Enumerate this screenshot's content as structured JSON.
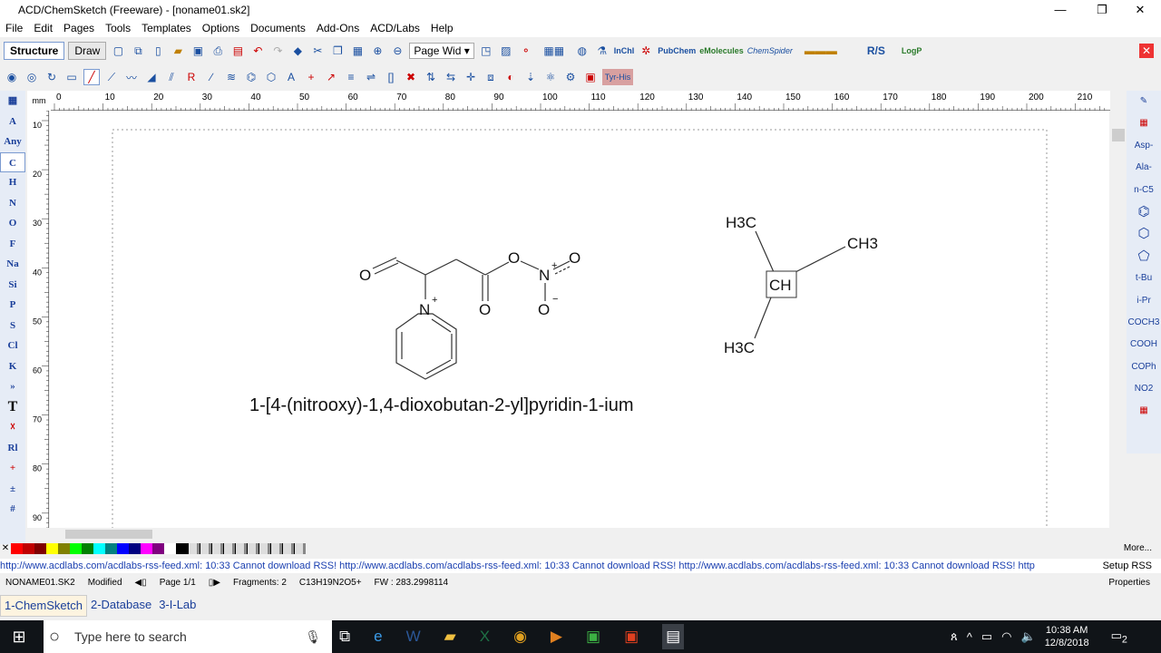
{
  "window": {
    "title": "ACD/ChemSketch (Freeware) - [noname01.sk2]",
    "minimize": "—",
    "restore": "❐",
    "close": "✕"
  },
  "menu": [
    "File",
    "Edit",
    "Pages",
    "Tools",
    "Templates",
    "Options",
    "Documents",
    "Add-Ons",
    "ACD/Labs",
    "Help"
  ],
  "toolbar": {
    "structure": "Structure",
    "draw": "Draw",
    "zoom_select": "Page Wid",
    "pubchem": "PubChem",
    "emolecules": "eMolecules",
    "chemspider": "ChemSpider",
    "rs": "R/S",
    "logp": "LogP",
    "inchi": "InChI"
  },
  "left_tools": [
    "A",
    "Any",
    "C",
    "H",
    "N",
    "O",
    "F",
    "Na",
    "Si",
    "P",
    "S",
    "Cl",
    "K",
    "»",
    "T",
    "☓",
    "Rl",
    "+",
    "±",
    "#"
  ],
  "right_tools": [
    "Asp-",
    "Ala-",
    "n-C5",
    "⌬",
    "⬡",
    "⬠",
    "t-Bu",
    "i-Pr",
    "COCH3",
    "COOH",
    "COPh",
    "NO2"
  ],
  "ruler": {
    "unit": "mm",
    "h_ticks": [
      "0",
      "10",
      "20",
      "30",
      "40",
      "50",
      "60",
      "70",
      "80",
      "90",
      "100",
      "110",
      "120",
      "130",
      "140",
      "150",
      "160",
      "170",
      "180",
      "190",
      "200",
      "210"
    ],
    "v_ticks": [
      "10",
      "20",
      "30",
      "40",
      "50",
      "60",
      "70",
      "80",
      "90"
    ]
  },
  "molecule1": {
    "atoms": {
      "o_aldehyde": "O",
      "n_pyr": "N",
      "n_plus": "+",
      "o_carbonyl": "O",
      "o_ester": "O",
      "n_nitro": "N",
      "nitro_plus": "+",
      "o_nitro1": "O",
      "o_nitro2": "O",
      "nitro_minus": "−"
    },
    "name": "1-[4-(nitrooxy)-1,4-dioxobutan-2-yl]pyridin-1-ium"
  },
  "molecule2": {
    "center": "CH",
    "top_left": "H3C",
    "right": "CH3",
    "bottom_left": "H3C"
  },
  "palette": [
    "#ff0000",
    "#c00000",
    "#800000",
    "#ffff00",
    "#808000",
    "#00ff00",
    "#008000",
    "#00ffff",
    "#008080",
    "#0000ff",
    "#000080",
    "#ff00ff",
    "#800080",
    "#ffffff",
    "#000000"
  ],
  "more": "More...",
  "rss": {
    "text": "http://www.acdlabs.com/acdlabs-rss-feed.xml: 10:33 Cannot download RSS!  http://www.acdlabs.com/acdlabs-rss-feed.xml: 10:33 Cannot download RSS!  http://www.acdlabs.com/acdlabs-rss-feed.xml: 10:33 Cannot download RSS!  http",
    "setup": "Setup RSS"
  },
  "status": {
    "file": "NONAME01.SK2",
    "modified": "Modified",
    "page": "Page 1/1",
    "fragments": "Fragments: 2",
    "formula": "C13H19N2O5+",
    "fw": "FW : 283.2998114",
    "properties": "Properties"
  },
  "tabs": [
    "1-ChemSketch",
    "2-Database",
    "3-I-Lab"
  ],
  "taskbar": {
    "search_placeholder": "Type here to search",
    "time": "10:38 AM",
    "date": "12/8/2018",
    "notifications": "2"
  }
}
